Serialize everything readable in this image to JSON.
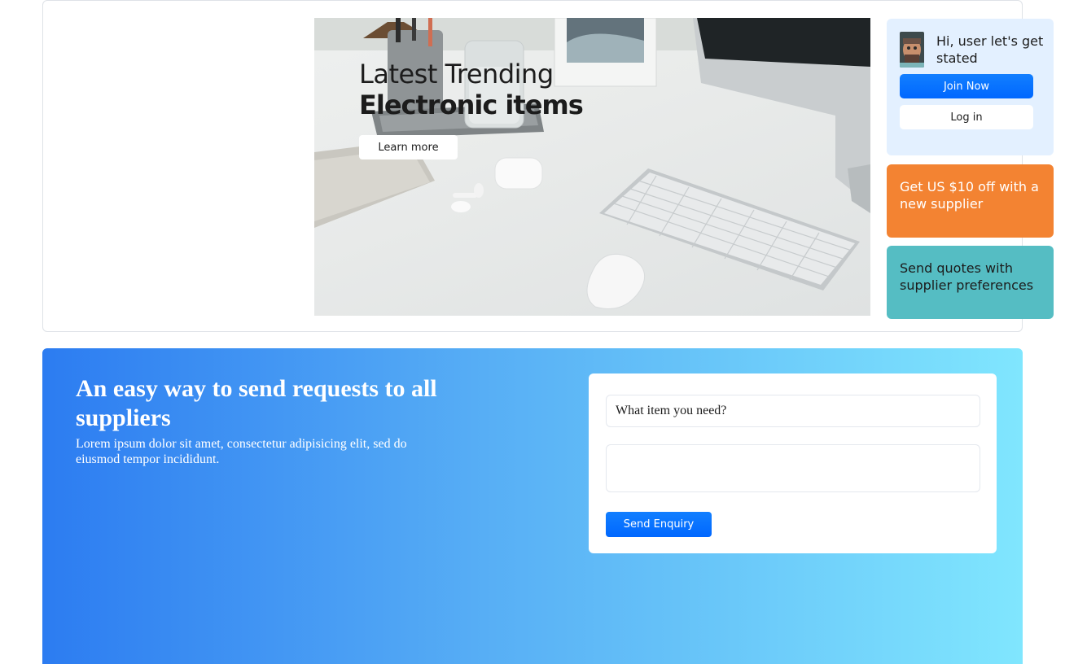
{
  "hero": {
    "title_light": "Latest Trending",
    "title_bold": "Electronic items",
    "cta_label": "Learn more"
  },
  "user_box": {
    "greeting": "Hi, user  let's get stated",
    "join_label": "Join Now",
    "login_label": "Log in"
  },
  "promos": {
    "orange_text": "Get US $10 off with a new supplier",
    "teal_text": "Send quotes with supplier preferences"
  },
  "enquiry": {
    "title": "An easy way to send requests to all suppliers",
    "description": "Lorem ipsum dolor sit amet, consectetur adipisicing elit, sed do eiusmod tempor incididunt.",
    "item_value": "What item you need?",
    "details_value": "",
    "send_label": "Send Enquiry"
  },
  "colors": {
    "primary_blue": "#0d6efd",
    "orange_promo": "#f38332",
    "teal_promo": "#55bdc3",
    "user_box_bg": "#e3f0ff",
    "gradient_start": "#2c7cf1",
    "gradient_end": "#80e6fe"
  }
}
